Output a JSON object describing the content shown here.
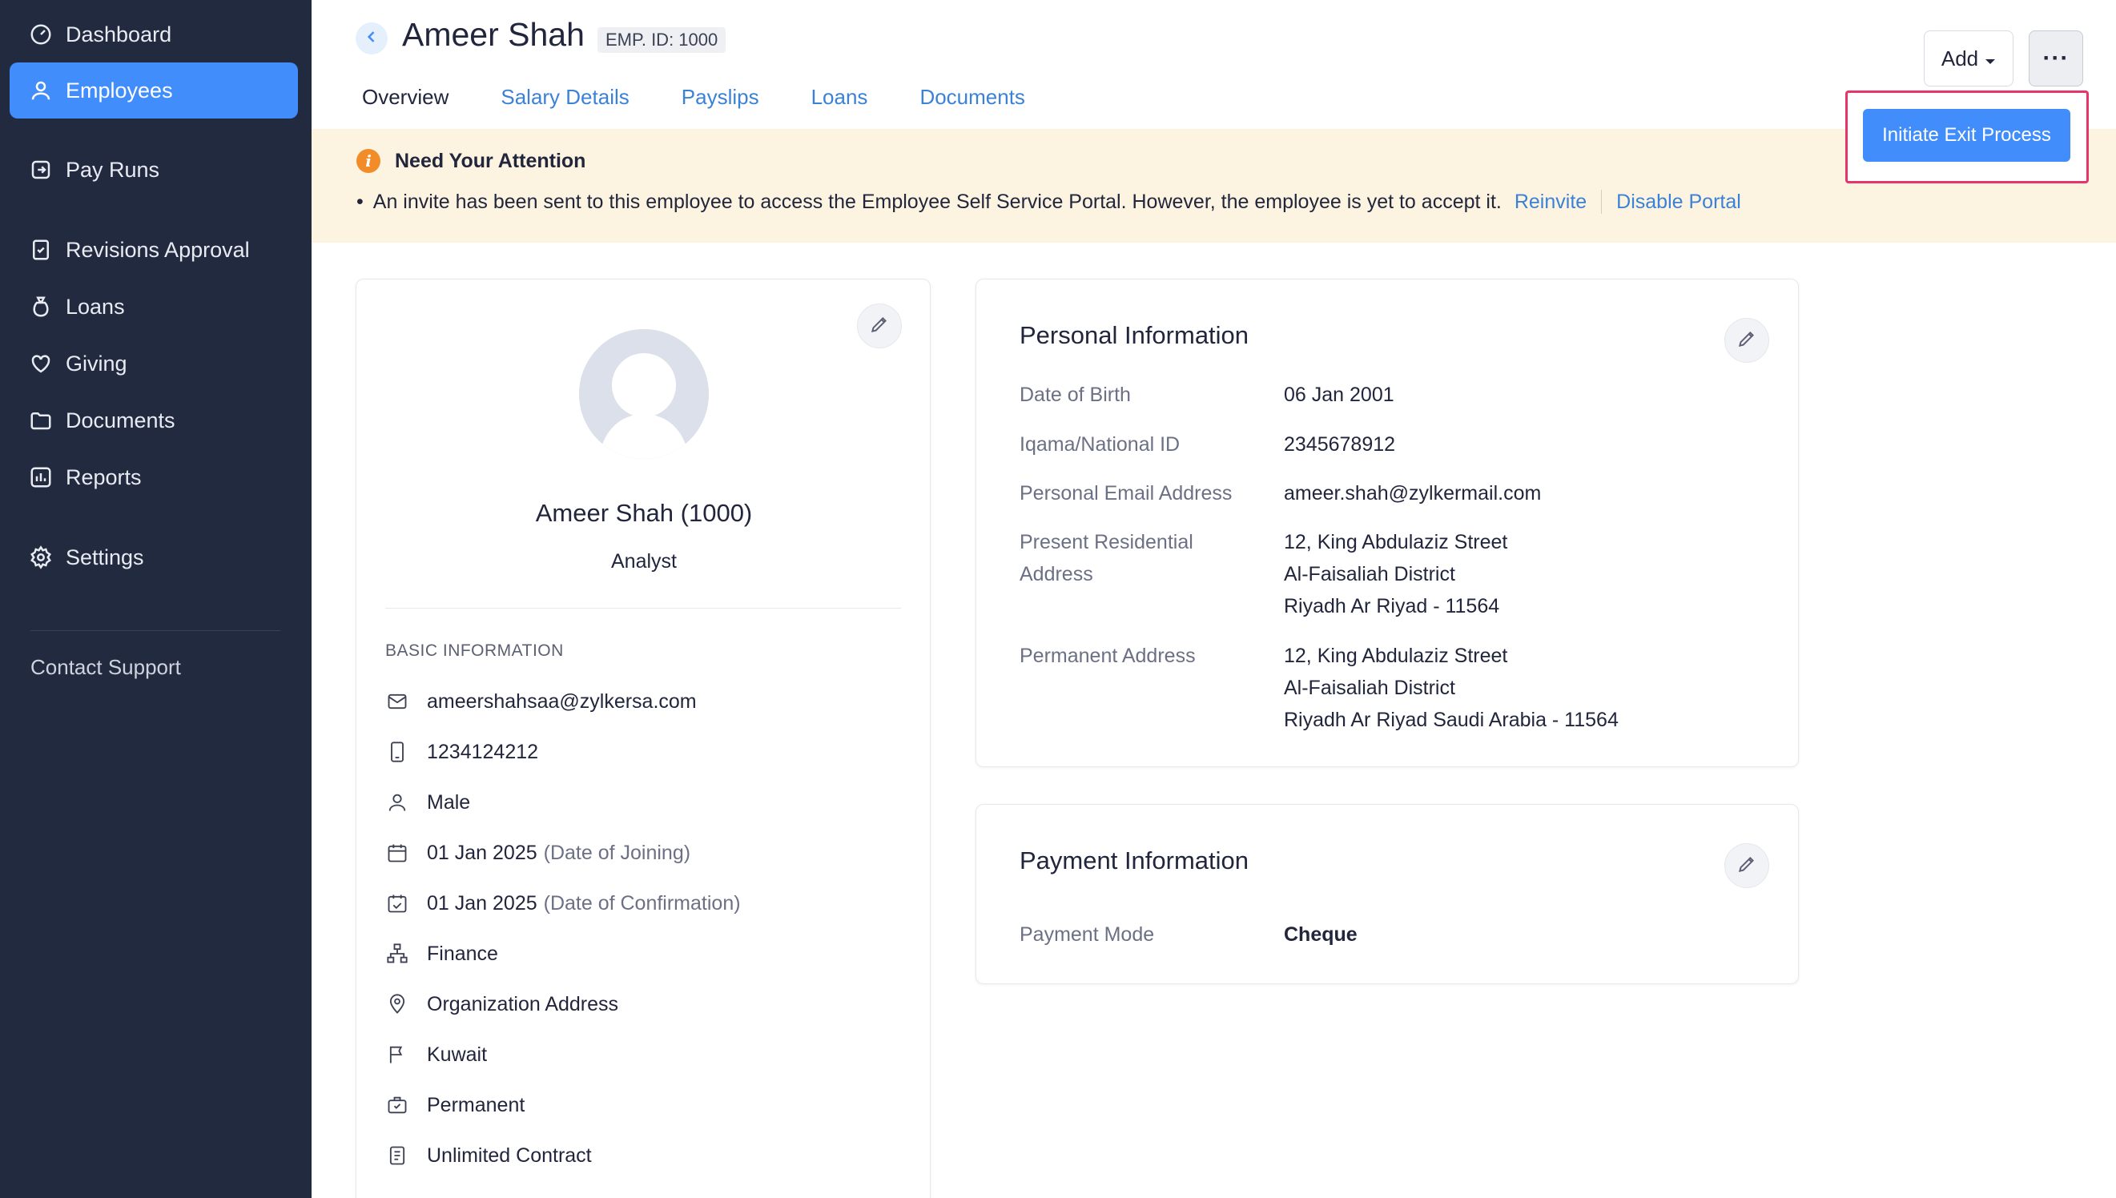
{
  "sidebar": {
    "items": [
      {
        "label": "Dashboard",
        "icon": "dashboard-icon"
      },
      {
        "label": "Employees",
        "icon": "user-icon",
        "active": true
      },
      {
        "label": "Pay Runs",
        "icon": "pay-runs-icon"
      },
      {
        "label": "Revisions Approval",
        "icon": "approval-icon"
      },
      {
        "label": "Loans",
        "icon": "money-bag-icon"
      },
      {
        "label": "Giving",
        "icon": "heart-icon"
      },
      {
        "label": "Documents",
        "icon": "folder-icon"
      },
      {
        "label": "Reports",
        "icon": "chart-icon"
      },
      {
        "label": "Settings",
        "icon": "gear-icon"
      }
    ],
    "contact_support": "Contact Support"
  },
  "header": {
    "title": "Ameer Shah",
    "emp_id": "EMP. ID: 1000",
    "add_label": "Add",
    "more_label": "···"
  },
  "tabs": [
    {
      "label": "Overview",
      "active": true
    },
    {
      "label": "Salary Details"
    },
    {
      "label": "Payslips"
    },
    {
      "label": "Loans"
    },
    {
      "label": "Documents"
    }
  ],
  "dropdown": {
    "initiate_exit": "Initiate Exit Process"
  },
  "attention": {
    "title": "Need Your Attention",
    "message": "An invite has been sent to this employee to access the Employee Self Service Portal. However, the employee is yet to accept it.",
    "reinvite": "Reinvite",
    "disable_portal": "Disable Portal"
  },
  "profile": {
    "name": "Ameer Shah (1000)",
    "role": "Analyst",
    "basic_heading": "BASIC INFORMATION",
    "email": "ameershahsaa@zylkersa.com",
    "phone": "1234124212",
    "gender": "Male",
    "joining_date": "01 Jan 2025",
    "joining_note": "(Date of Joining)",
    "confirmation_date": "01 Jan 2025",
    "confirmation_note": "(Date of Confirmation)",
    "department": "Finance",
    "location": "Organization Address",
    "country": "Kuwait",
    "employment_type": "Permanent",
    "contract": "Unlimited Contract"
  },
  "personal": {
    "title": "Personal Information",
    "fields": [
      {
        "label": "Date of Birth",
        "value": [
          "06 Jan 2001"
        ]
      },
      {
        "label": "Iqama/National ID",
        "value": [
          "2345678912"
        ]
      },
      {
        "label": "Personal Email Address",
        "value": [
          "ameer.shah@zylkermail.com"
        ]
      },
      {
        "label_lines": [
          "Present Residential",
          "Address"
        ],
        "value": [
          "12, King Abdulaziz Street",
          "Al-Faisaliah District",
          "Riyadh  Ar Riyad  - 11564"
        ]
      },
      {
        "label": "Permanent Address",
        "value": [
          "12, King Abdulaziz Street",
          "Al-Faisaliah District",
          "Riyadh  Ar Riyad  Saudi Arabia  - 11564"
        ]
      }
    ]
  },
  "payment": {
    "title": "Payment Information",
    "mode_label": "Payment Mode",
    "mode_value": "Cheque"
  },
  "colors": {
    "sidebar_bg": "#222a40",
    "accent": "#408dfb",
    "banner_bg": "#fdf3e1",
    "highlight": "#e8336b"
  }
}
